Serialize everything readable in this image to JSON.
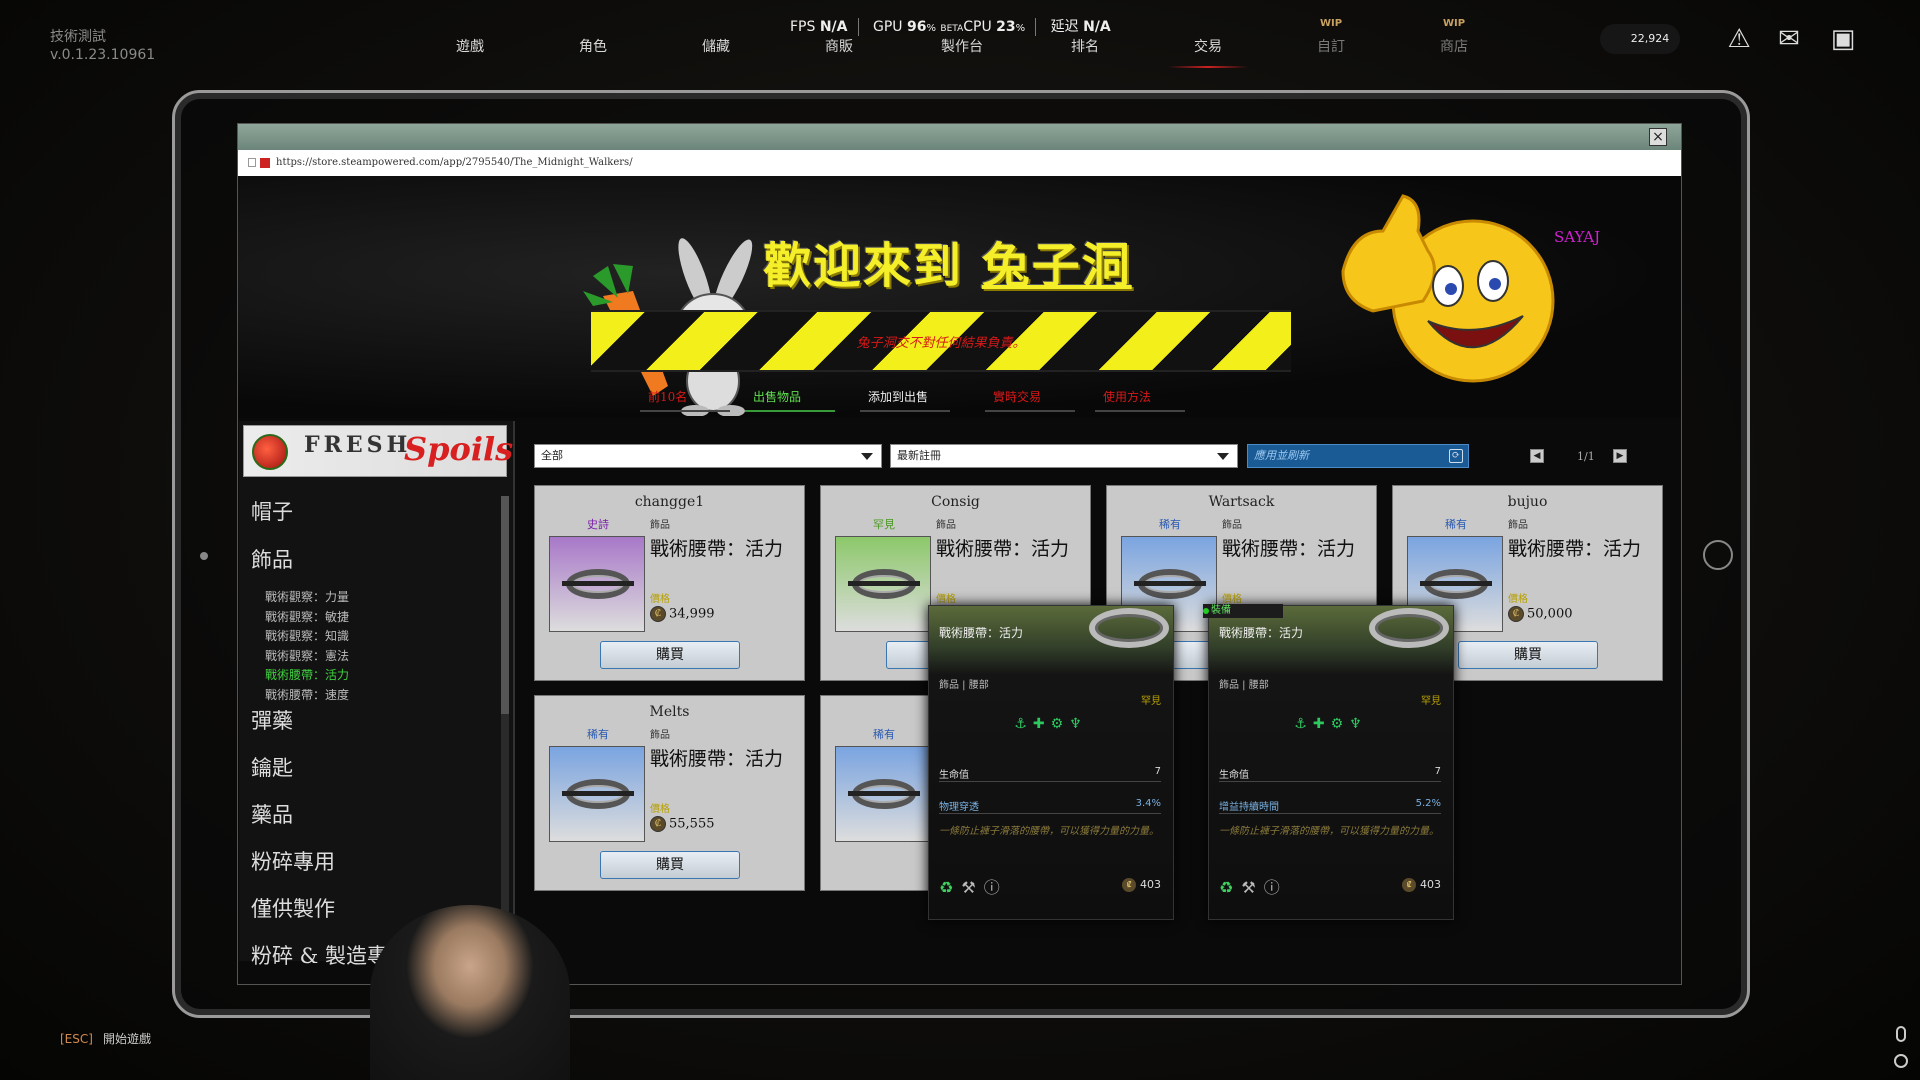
{
  "version": {
    "line1": "技術測試",
    "line2": "v.0.1.23.10961"
  },
  "stats": {
    "fps_label": "FPS",
    "fps_value": "N/A",
    "gpu_label": "GPU",
    "gpu_value": "96",
    "beta_label": "BETA",
    "cpu_label": "CPU",
    "cpu_value": "23",
    "latency_label": "延迟",
    "latency_value": "N/A"
  },
  "topnav": [
    {
      "label": "遊戲",
      "wip": false,
      "active": false
    },
    {
      "label": "角色",
      "wip": false,
      "active": false
    },
    {
      "label": "儲藏",
      "wip": false,
      "active": false
    },
    {
      "label": "商販",
      "wip": false,
      "active": false
    },
    {
      "label": "製作台",
      "wip": false,
      "active": false
    },
    {
      "label": "排名",
      "wip": false,
      "active": false
    },
    {
      "label": "交易",
      "wip": false,
      "active": true
    },
    {
      "label": "自訂",
      "wip": true,
      "active": false
    },
    {
      "label": "商店",
      "wip": true,
      "active": false
    }
  ],
  "wip_tag": "WIP",
  "coins": "22,924",
  "browser": {
    "url": "https://store.steampowered.com/app/2795540/The_Midnight_Walkers/",
    "close": "×"
  },
  "banner": {
    "title_plain": "歡迎來到 ",
    "title_link": "兔子洞",
    "hazard_text": "兔子洞交不對任何結果負責。",
    "tagline": "SAYAJ",
    "nav": [
      {
        "label": "前10名",
        "style": "red"
      },
      {
        "label": "出售物品",
        "style": "sel"
      },
      {
        "label": "添加到出售",
        "style": "white"
      },
      {
        "label": "實時交易",
        "style": "red"
      },
      {
        "label": "使用方法",
        "style": "red"
      }
    ]
  },
  "logo": {
    "fresh": "FRESH",
    "spoils": "Spoils"
  },
  "sidebar": {
    "categories": [
      "帽子",
      "飾品",
      "彈藥",
      "鑰匙",
      "藥品",
      "粉碎專用",
      "僅供製作",
      "粉碎 & 製造專"
    ],
    "subitems": [
      "戰術觀察：力量",
      "戰術觀察：敏捷",
      "戰術觀察：知識",
      "戰術觀察：憲法",
      "戰術腰帶：活力",
      "戰術腰帶：速度"
    ],
    "active_sub": 4
  },
  "filters": {
    "category": "全部",
    "sort": "最新註冊",
    "search_placeholder": "應用並刷新",
    "refresh_icon": "refresh-icon",
    "page": "1/1"
  },
  "listings": [
    {
      "seller": "changge1",
      "tier": "史詩",
      "tier_color": "#7a1ea8",
      "thumb_color": "#a878c8",
      "category": "飾品",
      "name": "戰術腰帶：活力",
      "price_label": "價格",
      "price": "34,999",
      "buy": "購買"
    },
    {
      "seller": "Consig",
      "tier": "罕見",
      "tier_color": "#4a9a20",
      "thumb_color": "#8cc86a",
      "category": "飾品",
      "name": "戰術腰帶：活力",
      "price_label": "價格",
      "price": "",
      "buy": "購買"
    },
    {
      "seller": "Wartsack",
      "tier": "稀有",
      "tier_color": "#2a5ab0",
      "thumb_color": "#7aa4e0",
      "category": "飾品",
      "name": "戰術腰帶：活力",
      "price_label": "價格",
      "price": "",
      "buy": "購買"
    },
    {
      "seller": "bujuo",
      "tier": "稀有",
      "tier_color": "#2a5ab0",
      "thumb_color": "#7aa4e0",
      "category": "飾品",
      "name": "戰術腰帶：活力",
      "price_label": "價格",
      "price": "50,000",
      "buy": "購買"
    },
    {
      "seller": "Melts",
      "tier": "稀有",
      "tier_color": "#2a5ab0",
      "thumb_color": "#7aa4e0",
      "category": "飾品",
      "name": "戰術腰帶：活力",
      "price_label": "價格",
      "price": "55,555",
      "buy": "購買"
    },
    {
      "seller": "",
      "tier": "稀有",
      "tier_color": "#2a5ab0",
      "thumb_color": "#7aa4e0",
      "category": "",
      "name": "",
      "price_label": "",
      "price": "",
      "buy": ""
    }
  ],
  "tooltips": [
    {
      "name": "戰術腰帶：活力",
      "category": "飾品 | 腰部",
      "rarity": "罕見",
      "symbols": "⚓✚⚙♆",
      "stat1_k": "生命值",
      "stat1_v": "7",
      "stat2_k": "物理穿透",
      "stat2_v": "3.4%",
      "desc": "一條防止褲子滑落的腰帶，可以獲得力量的力量。",
      "value": "403"
    },
    {
      "name": "戰術腰帶：活力",
      "category": "飾品 | 腰部",
      "rarity": "罕見",
      "symbols": "⚓✚⚙♆",
      "stat1_k": "生命值",
      "stat1_v": "7",
      "stat2_k": "增益持續時間",
      "stat2_v": "5.2%",
      "desc": "一條防止褲子滑落的腰帶，可以獲得力量的力量。",
      "value": "403"
    }
  ],
  "equip_badge": "裝備",
  "esc": {
    "key": "[ESC]",
    "label": "開始遊戲"
  }
}
